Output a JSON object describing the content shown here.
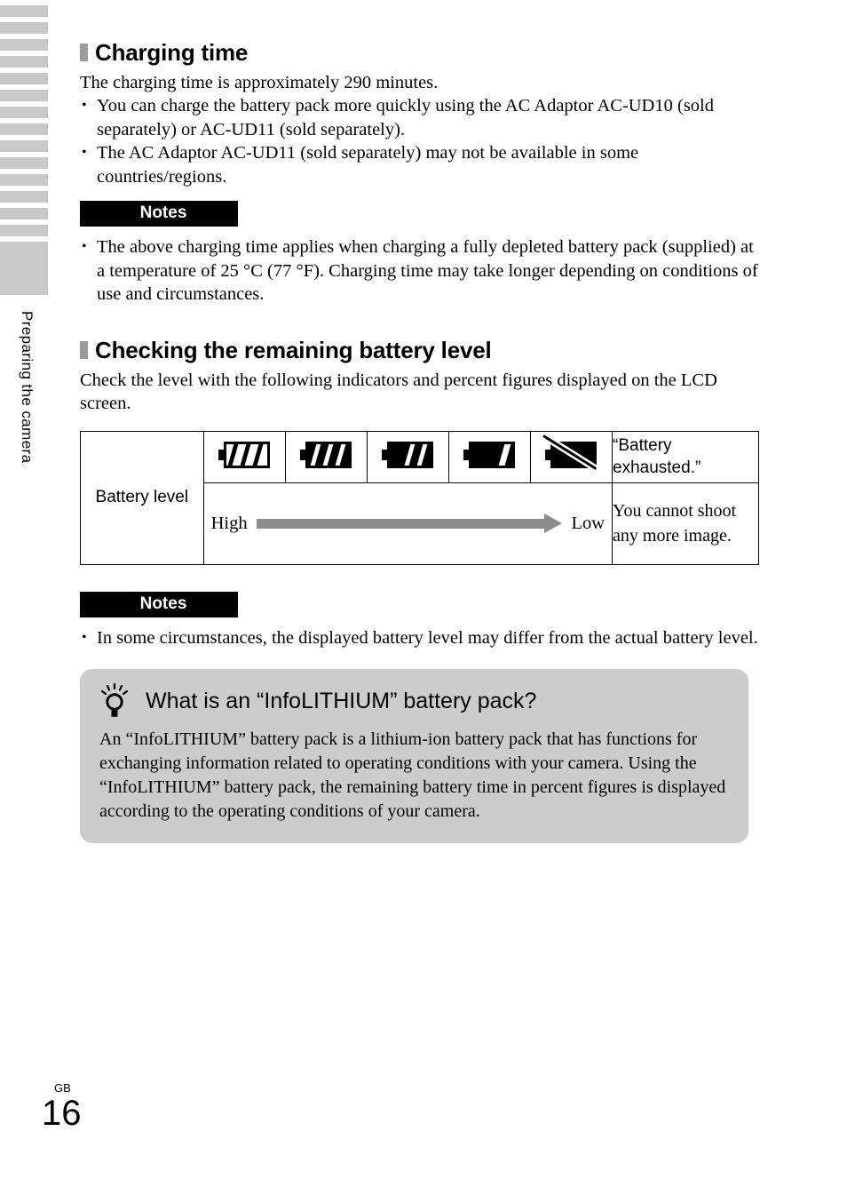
{
  "sidebar": {
    "section_label": "Preparing the camera",
    "tab_stripe_count": 14
  },
  "footer": {
    "region": "GB",
    "page_number": "16"
  },
  "sections": [
    {
      "heading": "Charging time",
      "intro": "The charging time is approximately 290 minutes.",
      "bullets": [
        "You can charge the battery pack more quickly using the AC Adaptor AC-UD10 (sold separately) or AC-UD11 (sold separately).",
        "The AC Adaptor AC-UD11 (sold separately) may not be available in some countries/regions."
      ],
      "notes_label": "Notes",
      "notes": [
        "The above charging time applies when charging a fully depleted battery pack (supplied) at a temperature of 25 °C (77 °F). Charging time may take longer depending on conditions of use and circumstances."
      ]
    },
    {
      "heading": "Checking the remaining battery level",
      "intro": "Check the level with the following indicators and percent figures displayed on the LCD screen.",
      "notes_label": "Notes",
      "notes": [
        "In some circumstances, the displayed battery level may differ from the actual battery level."
      ]
    }
  ],
  "battery_table": {
    "row_label": "Battery level",
    "icons": [
      {
        "name": "battery-full-icon",
        "bars": 3,
        "style": "outline"
      },
      {
        "name": "battery-three-quarter-icon",
        "bars": 3,
        "style": "filled"
      },
      {
        "name": "battery-half-icon",
        "bars": 2,
        "style": "filled"
      },
      {
        "name": "battery-low-icon",
        "bars": 1,
        "style": "filled"
      },
      {
        "name": "battery-exhausted-icon",
        "bars": 0,
        "style": "slashed"
      }
    ],
    "exhausted_text": "“Battery exhausted.”",
    "scale_high": "High",
    "scale_low": "Low",
    "cannot_shoot_text": "You cannot shoot any more image."
  },
  "tip": {
    "icon": "lightbulb-icon",
    "title": "What is an “InfoLITHIUM” battery pack?",
    "body": "An “InfoLITHIUM” battery pack is a lithium-ion battery pack that has functions for exchanging information related to operating conditions with your camera. Using the “InfoLITHIUM” battery pack, the remaining battery time in percent figures is displayed according to the operating conditions of your camera.",
    "background_color": "#cccccc"
  },
  "colors": {
    "tab_gray": "#c8c8c8",
    "marker_gray": "#9b9b9b",
    "arrow_gray": "#8c8c8c",
    "notes_bar": "#000000"
  }
}
